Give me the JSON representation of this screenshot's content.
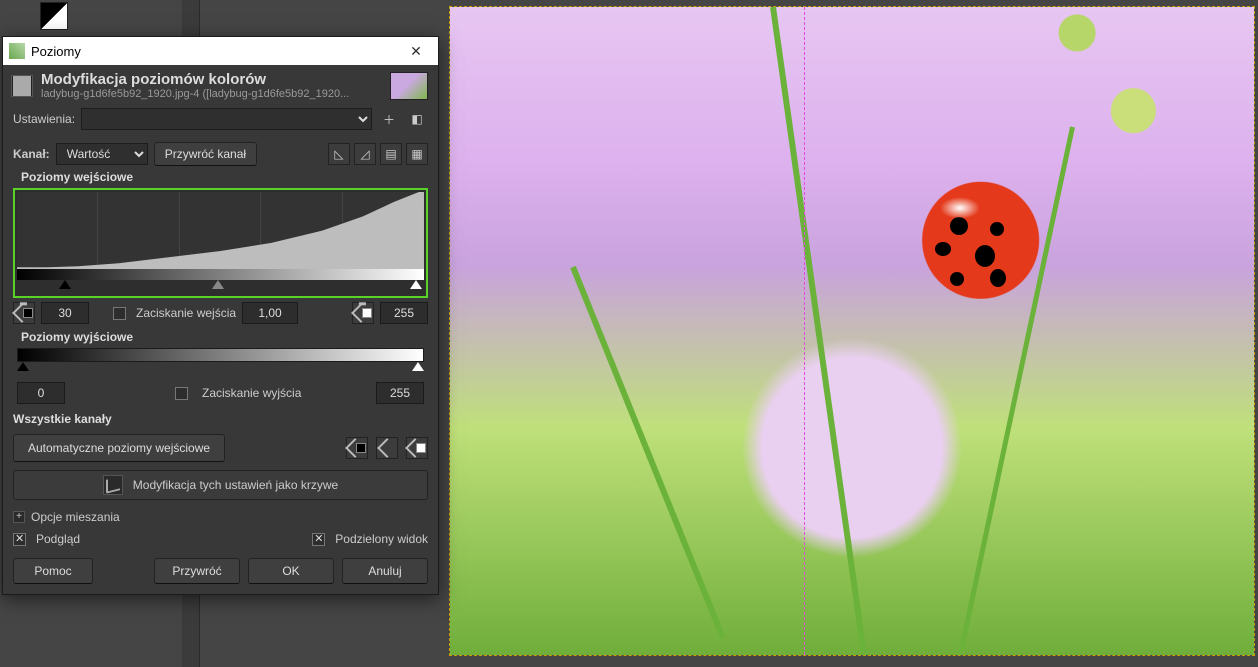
{
  "window": {
    "title": "Poziomy"
  },
  "header": {
    "title": "Modyfikacja poziomów kolorów",
    "subtitle": "ladybug-g1d6fe5b92_1920.jpg-4 ([ladybug-g1d6fe5b92_1920..."
  },
  "presets": {
    "label": "Ustawienia:",
    "value": ""
  },
  "channel": {
    "label": "Kanał:",
    "value": "Wartość",
    "reset_label": "Przywróć kanał"
  },
  "input_levels": {
    "section": "Poziomy wejściowe",
    "low": "30",
    "clamp_label": "Zaciskanie wejścia",
    "gamma": "1,00",
    "high": "255"
  },
  "output_levels": {
    "section": "Poziomy wyjściowe",
    "low": "0",
    "clamp_label": "Zaciskanie wyjścia",
    "high": "255"
  },
  "all_channels": {
    "section": "Wszystkie kanały",
    "auto": "Automatyczne poziomy wejściowe"
  },
  "curves_btn": "Modyfikacja tych ustawień jako krzywe",
  "blend": {
    "label": "Opcje mieszania"
  },
  "preview": {
    "label": "Podgląd",
    "split_label": "Podzielony widok"
  },
  "footer": {
    "help": "Pomoc",
    "reset": "Przywróć",
    "ok": "OK",
    "cancel": "Anuluj"
  }
}
